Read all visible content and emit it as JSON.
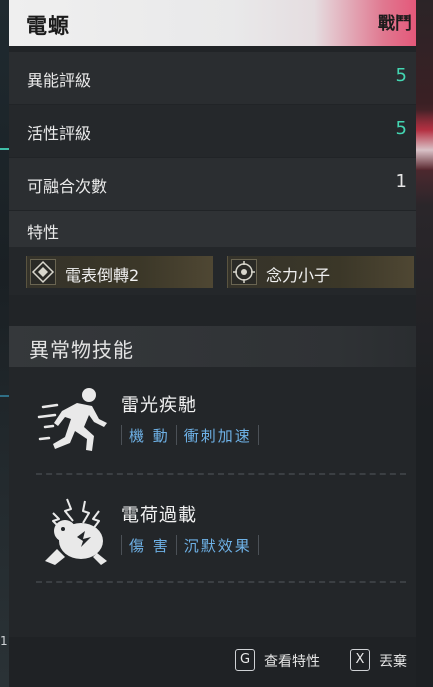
{
  "header": {
    "title": "電螈",
    "tag": "戰鬥"
  },
  "stats": [
    {
      "label": "異能評級",
      "value": "5",
      "accent": true
    },
    {
      "label": "活性評級",
      "value": "5",
      "accent": true
    },
    {
      "label": "可融合次數",
      "value": "1",
      "accent": false
    }
  ],
  "traits": {
    "section_label": "特性",
    "items": [
      {
        "name": "電表倒轉2",
        "icon": "diamond-icon"
      },
      {
        "name": "念力小子",
        "icon": "crosshair-icon"
      }
    ]
  },
  "anomaly_skills": {
    "section_label": "異常物技能",
    "skills": [
      {
        "name": "雷光疾馳",
        "icon": "running-figure-icon",
        "tags": [
          "機 動",
          "衝刺加速"
        ]
      },
      {
        "name": "電荷過載",
        "icon": "electric-creature-icon",
        "tags": [
          "傷 害",
          "沉默效果"
        ]
      }
    ]
  },
  "footer": {
    "view_traits_key": "G",
    "view_traits_label": "查看特性",
    "discard_key": "X",
    "discard_label": "丟棄"
  },
  "background": {
    "left_digit": "1"
  },
  "colors": {
    "accent_teal": "#43d6b2",
    "tag_blue": "#6eb1e6",
    "header_pink": "#e4587a"
  }
}
